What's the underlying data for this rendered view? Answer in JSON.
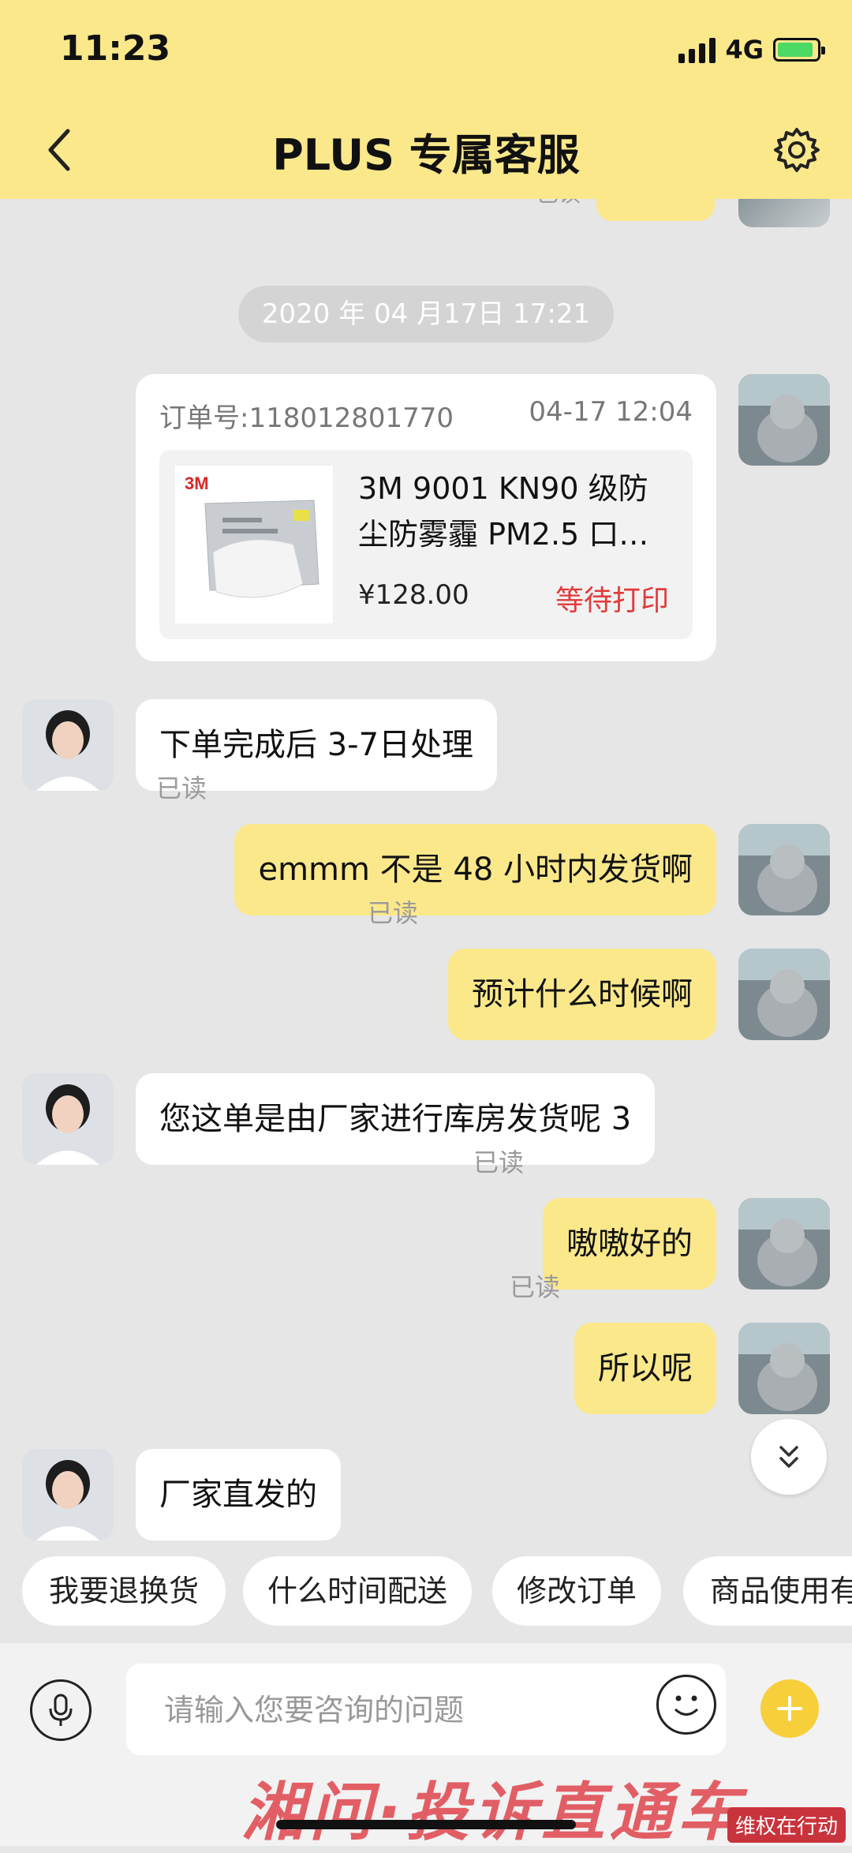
{
  "status_bar": {
    "time": "11:23",
    "network": "4G"
  },
  "header": {
    "title": "PLUS 专属客服"
  },
  "chat": {
    "partial_read": "已读",
    "timestamp": "2020 年 04 月17日 17:21",
    "order_card": {
      "order_number": "订单号:118012801770",
      "order_time": "04-17 12:04",
      "product_name": "3M 9001 KN90 级防尘防雾霾 PM2.5 口…",
      "price": "¥128.00",
      "status": "等待打印",
      "status_color": "#e23a3a"
    },
    "messages": [
      {
        "sender": "agent",
        "text": "下单完成后 3-7日处理"
      },
      {
        "sender": "user",
        "text": "emmm 不是 48 小时内发货啊",
        "read": "已读"
      },
      {
        "sender": "user",
        "text": "预计什么时候啊",
        "read": "已读"
      },
      {
        "sender": "agent",
        "text": "您这单是由厂家进行库房发货呢 3"
      },
      {
        "sender": "user",
        "text": "嗷嗷好的",
        "read": "已读"
      },
      {
        "sender": "user",
        "text": "所以呢",
        "read": "已读"
      },
      {
        "sender": "agent",
        "text": "厂家直发的"
      }
    ]
  },
  "quick_replies": [
    "我要退换货",
    "什么时间配送",
    "修改订单",
    "商品使用有"
  ],
  "input": {
    "placeholder": "请输入您要咨询的问题"
  },
  "watermark": {
    "text": "湘问·投诉直通车",
    "stamp": "维权在行动"
  },
  "colors": {
    "accent": "#fae88b",
    "background": "#e6e6e6",
    "plus": "#f7cf3a"
  }
}
